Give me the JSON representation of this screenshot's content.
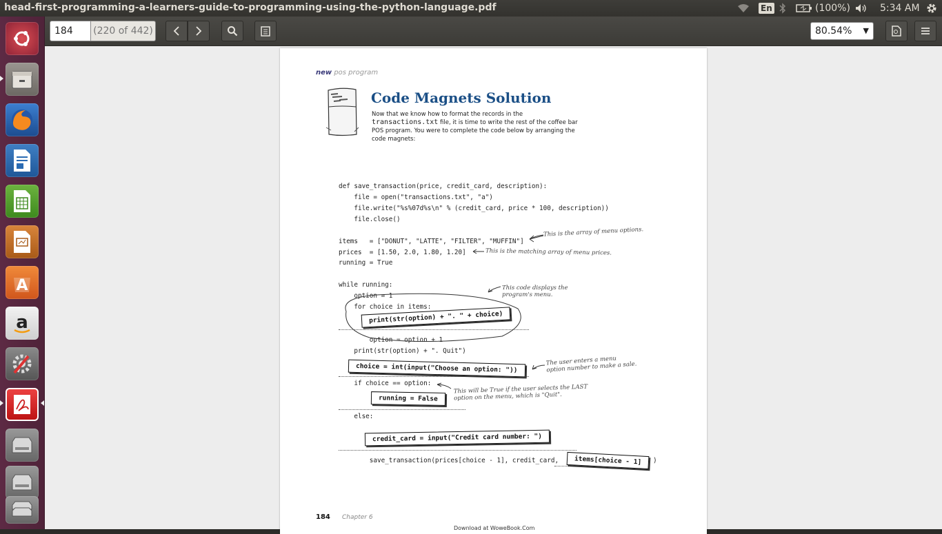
{
  "window": {
    "title": "head-first-programming-a-learners-guide-to-programming-using-the-python-language.pdf"
  },
  "tray": {
    "language": "En",
    "battery": "(100%)",
    "clock": "5:34 AM"
  },
  "launcher": {
    "items": [
      "ubuntu-dash",
      "files",
      "firefox",
      "libreoffice-writer",
      "libreoffice-calc",
      "libreoffice-impress",
      "ubuntu-software",
      "amazon",
      "system-settings",
      "document-viewer",
      "drive",
      "drive",
      "trash"
    ]
  },
  "toolbar": {
    "page_input": "184",
    "page_count": "(220 of 442)",
    "zoom": "80.54%"
  },
  "document": {
    "section_label_strong": "new",
    "section_label_rest": "pos program",
    "title": "Code Magnets Solution",
    "intro_1": "Now that we know how to format the records in the",
    "intro_mono": "transactions.txt",
    "intro_2": " file, it is time to write the rest of the coffee bar POS program. You were to complete the code below by arranging the code magnets:",
    "code": {
      "l1": "def save_transaction(price, credit_card, description):",
      "l2": "    file = open(\"transactions.txt\", \"a\")",
      "l3": "    file.write(\"%s%07d%s\\n\" % (credit_card, price * 100, description))",
      "l4": "    file.close()",
      "l5": "items   = [\"DONUT\", \"LATTE\", \"FILTER\", \"MUFFIN\"]",
      "l6": "prices  = [1.50, 2.0, 1.80, 1.20]",
      "l7": "running = True",
      "l8": "while running:",
      "l9": "    option = 1",
      "l10": "    for choice in items:",
      "l11": "        option = option + 1",
      "l12": "    print(str(option) + \". Quit\")",
      "l13": "    if choice == option:",
      "l14": "    else:",
      "l15": "        save_transaction(prices[choice - 1], credit_card,",
      "l15_end": ")"
    },
    "magnets": {
      "m1": "print(str(option) + \". \" + choice)",
      "m2": "choice = int(input(\"Choose an option: \"))",
      "m3": "running = False",
      "m4": "credit_card = input(\"Credit card number: \")",
      "m5": "items[choice - 1]"
    },
    "notes": {
      "n1": "This is the array of menu options.",
      "n2": "This is the matching array of menu prices.",
      "n3": "This code displays the\nprogram's menu.",
      "n4": "The user enters a menu\noption number to make a sale.",
      "n5": "This will be True if the user selects the LAST\noption on the menu, which is \"Quit\"."
    },
    "page_number": "184",
    "chapter": "Chapter 6",
    "download": "Download at WoweBook.Com"
  }
}
